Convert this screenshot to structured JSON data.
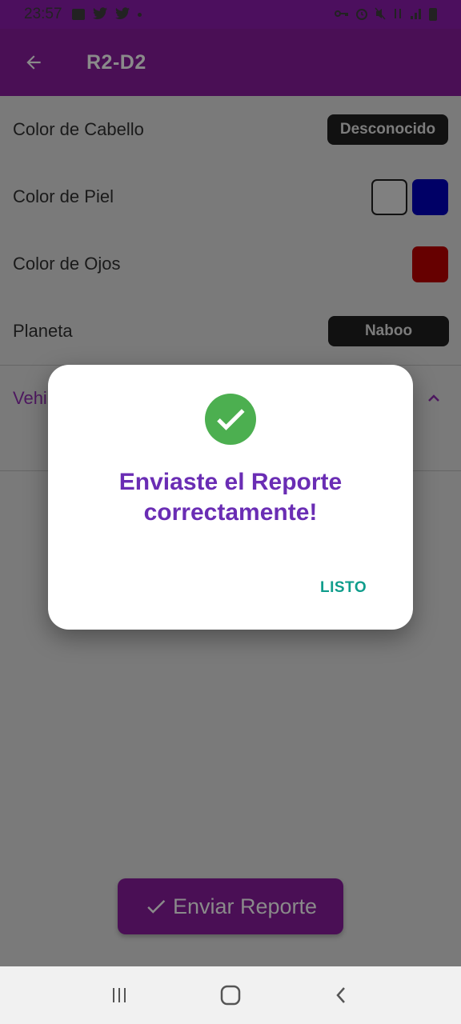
{
  "status": {
    "time": "23:57"
  },
  "app_bar": {
    "title": "R2-D2"
  },
  "details": {
    "hair_label": "Color de Cabello",
    "hair_value": "Desconocido",
    "skin_label": "Color de Piel",
    "skin_colors": [
      "#ffffff",
      "#0000cc"
    ],
    "eye_label": "Color de Ojos",
    "eye_color": "#cc0000",
    "planet_label": "Planeta",
    "planet_value": "Naboo",
    "vehicles_label": "Vehi"
  },
  "submit_button": {
    "label": "Enviar Reporte"
  },
  "dialog": {
    "message": "Enviaste el Reporte correctamente!",
    "ok_label": "LISTO"
  },
  "colors": {
    "primary": "#8a1ca8",
    "accent_purple": "#6a2db4",
    "success": "#4caf50",
    "teal": "#0f9d8c"
  }
}
